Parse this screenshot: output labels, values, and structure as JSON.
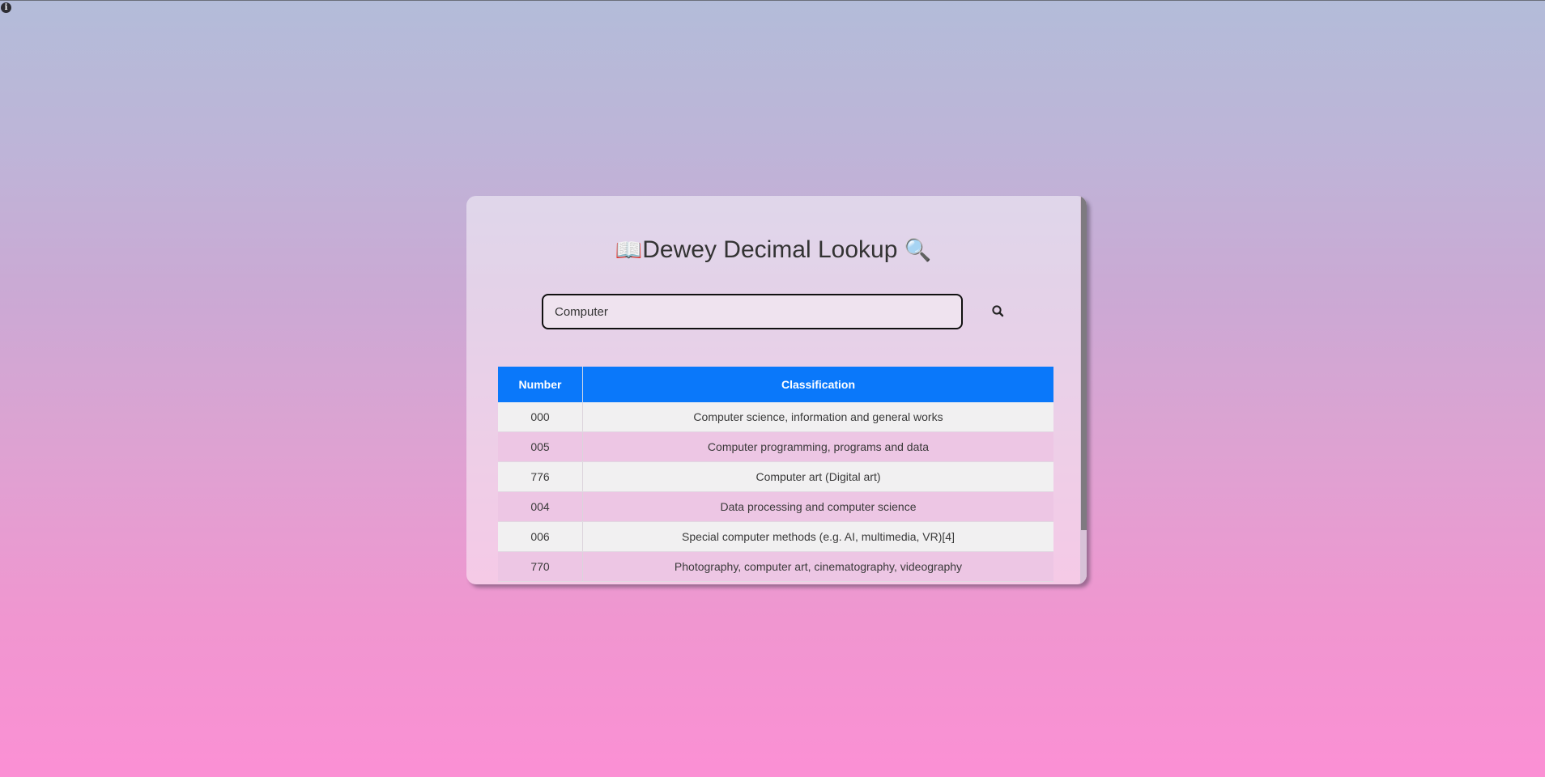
{
  "app": {
    "title_prefix_emoji": "📖",
    "title": "Dewey Decimal Lookup",
    "title_suffix_emoji": "🔍"
  },
  "search": {
    "value": "Computer",
    "placeholder": "",
    "button_icon": "search-icon"
  },
  "table": {
    "headers": {
      "number": "Number",
      "classification": "Classification"
    },
    "rows": [
      {
        "number": "000",
        "classification": "Computer science, information and general works"
      },
      {
        "number": "005",
        "classification": "Computer programming, programs and data"
      },
      {
        "number": "776",
        "classification": "Computer art (Digital art)"
      },
      {
        "number": "004",
        "classification": "Data processing and computer science"
      },
      {
        "number": "006",
        "classification": "Special computer methods (e.g. AI, multimedia, VR)[4]"
      },
      {
        "number": "770",
        "classification": "Photography, computer art, cinematography, videography"
      }
    ]
  },
  "colors": {
    "header_bg": "#0a78fa",
    "row_odd": "#f1f0f1",
    "row_even": "#edc6e4",
    "gradient_top": "#b3bcd9",
    "gradient_bottom": "#fb90d4"
  },
  "icons": {
    "top_left": "info-icon",
    "search_button": "search-icon"
  }
}
